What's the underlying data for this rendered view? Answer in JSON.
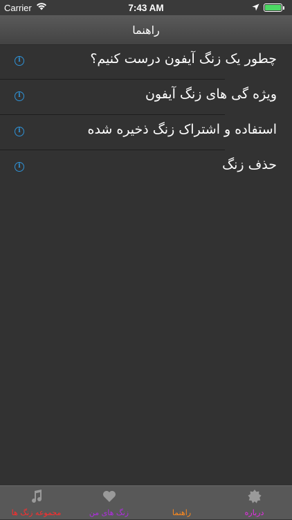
{
  "status": {
    "carrier": "Carrier",
    "time": "7:43 AM"
  },
  "nav": {
    "title": "راهنما"
  },
  "rows": [
    {
      "label": "چطور یک زنگ آیفون درست کنیم؟"
    },
    {
      "label": "ویژه گی های زنگ آیفون"
    },
    {
      "label": "استفاده و اشتراک زنگ ذخیره شده"
    },
    {
      "label": "حذف زنگ"
    }
  ],
  "tabs": [
    {
      "label": "مجموعه زنگ ها",
      "icon": "music-note-icon",
      "color": "#ff2d2d"
    },
    {
      "label": "زنگ های من",
      "icon": "heart-icon",
      "color": "#b02de0"
    },
    {
      "label": "راهنما",
      "icon": "",
      "color": "#ff8a1d"
    },
    {
      "label": "درباره",
      "icon": "badge-icon",
      "color": "#e62de6"
    }
  ]
}
